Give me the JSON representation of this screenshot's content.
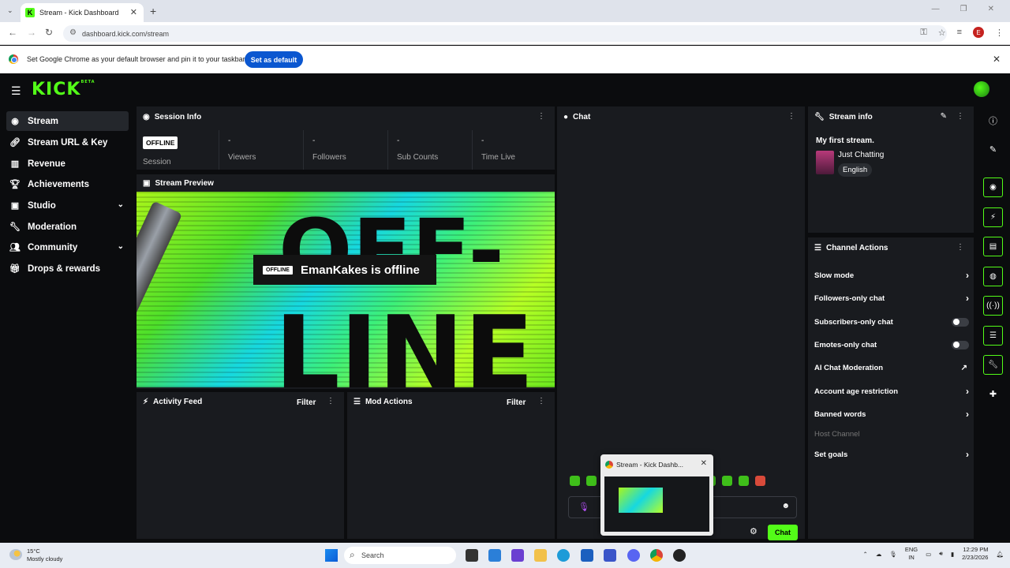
{
  "browser": {
    "tab_title": "Stream - Kick Dashboard",
    "url": "dashboard.kick.com/stream",
    "profile_initial": "E",
    "infobar_message": "Set Google Chrome as your default browser and pin it to your taskbar",
    "infobar_button": "Set as default"
  },
  "app": {
    "logo": "KICK",
    "logo_tag": "BETA",
    "accent": "#53fc18"
  },
  "sidebar": {
    "items": [
      {
        "label": "Stream",
        "icon": "broadcast-icon"
      },
      {
        "label": "Stream URL & Key",
        "icon": "link-icon"
      },
      {
        "label": "Revenue",
        "icon": "chart-icon"
      },
      {
        "label": "Achievements",
        "icon": "trophy-icon"
      },
      {
        "label": "Studio",
        "icon": "studio-icon"
      },
      {
        "label": "Moderation",
        "icon": "wrench-icon"
      },
      {
        "label": "Community",
        "icon": "community-icon"
      },
      {
        "label": "Drops & rewards",
        "icon": "gift-icon"
      }
    ]
  },
  "session": {
    "title": "Session Info",
    "status": "OFFLINE",
    "session_label": "Session",
    "stats": [
      {
        "value": "-",
        "label": "Viewers"
      },
      {
        "value": "-",
        "label": "Followers"
      },
      {
        "value": "-",
        "label": "Sub Counts"
      },
      {
        "value": "-",
        "label": "Time Live"
      }
    ]
  },
  "preview": {
    "title": "Stream Preview",
    "badge": "OFFLINE",
    "message": "EmanKakes is offline",
    "art_text_1": "OFF-",
    "art_text_2": "LINE"
  },
  "activity": {
    "title": "Activity Feed",
    "filter": "Filter"
  },
  "mod_actions": {
    "title": "Mod Actions",
    "filter": "Filter"
  },
  "chat": {
    "title": "Chat",
    "send_label": "Chat"
  },
  "stream_info": {
    "title": "Stream info",
    "stream_title": "My first stream.",
    "category": "Just Chatting",
    "language": "English"
  },
  "channel_actions": {
    "title": "Channel Actions",
    "rows": [
      {
        "label": "Slow mode",
        "control": "arrow"
      },
      {
        "label": "Followers-only chat",
        "control": "arrow"
      },
      {
        "label": "Subscribers-only chat",
        "control": "toggle"
      },
      {
        "label": "Emotes-only chat",
        "control": "toggle"
      },
      {
        "label": "AI Chat Moderation",
        "control": "external"
      },
      {
        "label": "Account age restriction",
        "control": "arrow"
      },
      {
        "label": "Banned words",
        "control": "arrow"
      },
      {
        "label": "Host Channel",
        "control": "none"
      },
      {
        "label": "Set goals",
        "control": "arrow"
      }
    ]
  },
  "tab_popup": {
    "title": "Stream - Kick Dashb..."
  },
  "taskbar": {
    "temp": "15°C",
    "weather": "Mostly cloudy",
    "search": "Search",
    "lang_1": "ENG",
    "lang_2": "IN",
    "time": "12:29 PM",
    "date": "2/23/2026"
  }
}
